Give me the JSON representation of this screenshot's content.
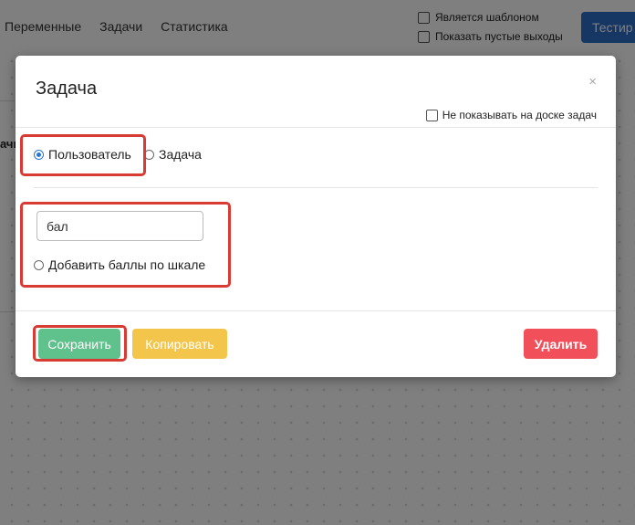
{
  "background": {
    "nav": [
      "Переменные",
      "Задачи",
      "Статистика"
    ],
    "checkboxes": [
      "Является шаблоном",
      "Показать пустые выходы"
    ],
    "test_button": "Тестир",
    "side_text": "ачи"
  },
  "modal": {
    "title": "Задача",
    "close": "×",
    "hide_on_board_label": "Не показывать на доске задач",
    "radio_user": "Пользователь",
    "radio_task": "Задача",
    "input_value": "бал",
    "scale_label": "Добавить баллы по шкале",
    "buttons": {
      "save": "Сохранить",
      "copy": "Копировать",
      "delete": "Удалить"
    }
  },
  "colors": {
    "save": "#5fc18b",
    "copy": "#f3c64b",
    "delete": "#f1505a",
    "highlight": "#d83b33",
    "primary": "#2d6ec9"
  }
}
